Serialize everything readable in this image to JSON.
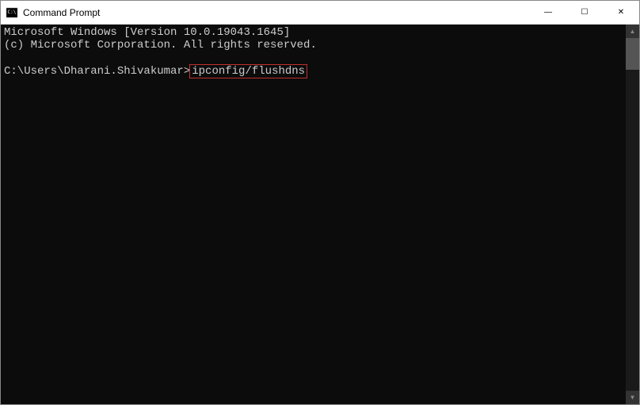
{
  "titlebar": {
    "title": "Command Prompt",
    "controls": {
      "minimize": "—",
      "maximize": "☐",
      "close": "✕"
    }
  },
  "console": {
    "line1": "Microsoft Windows [Version 10.0.19043.1645]",
    "line2": "(c) Microsoft Corporation. All rights reserved.",
    "blank": "",
    "prompt": "C:\\Users\\Dharani.Shivakumar>",
    "command": "ipconfig/flushdns"
  },
  "scrollbar": {
    "up": "▲",
    "down": "▼"
  }
}
